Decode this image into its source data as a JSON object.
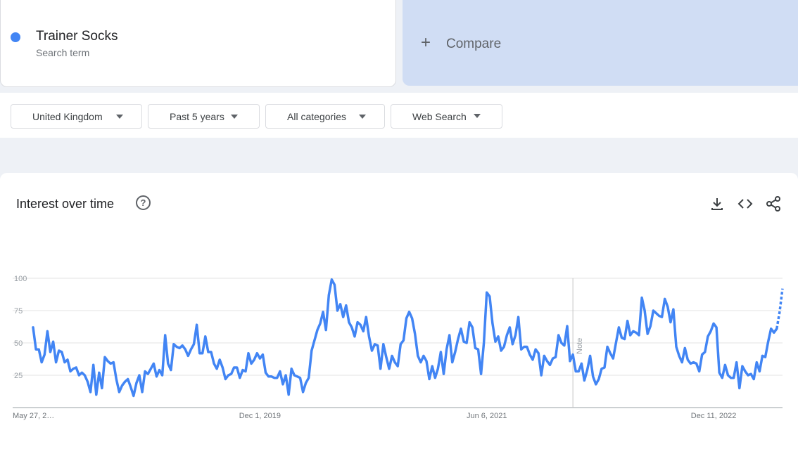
{
  "term": {
    "name": "Trainer Socks",
    "subtitle": "Search term",
    "color": "#4285f4"
  },
  "compare": {
    "label": "Compare"
  },
  "filters": [
    {
      "label": "United Kingdom"
    },
    {
      "label": "Past 5 years"
    },
    {
      "label": "All categories"
    },
    {
      "label": "Web Search"
    }
  ],
  "chart": {
    "title": "Interest over time",
    "icons": [
      "help-icon",
      "download-icon",
      "embed-icon",
      "share-icon"
    ],
    "note_label": "Note"
  },
  "chart_data": {
    "type": "line",
    "title": "Interest over time",
    "xlabel": "",
    "ylabel": "",
    "ylim": [
      0,
      100
    ],
    "yticks": [
      25,
      50,
      75,
      100
    ],
    "grid": true,
    "x_tick_labels": [
      "May 27, 2…",
      "Dec 1, 2019",
      "Jun 6, 2021",
      "Dec 11, 2022"
    ],
    "x_start": "2018-05-27",
    "x_step_days": 7,
    "note_date": "2022-01-02",
    "partial_last_points": 2,
    "series": [
      {
        "name": "Trainer Socks",
        "color": "#4285f4",
        "values": [
          62,
          45,
          45,
          35,
          41,
          59,
          43,
          51,
          35,
          44,
          43,
          35,
          37,
          28,
          30,
          31,
          25,
          27,
          25,
          20,
          12,
          33,
          10,
          27,
          15,
          39,
          36,
          34,
          35,
          22,
          12,
          17,
          20,
          22,
          16,
          9,
          19,
          25,
          12,
          28,
          26,
          30,
          34,
          24,
          29,
          25,
          56,
          34,
          29,
          49,
          47,
          46,
          48,
          45,
          40,
          45,
          49,
          64,
          42,
          42,
          55,
          43,
          43,
          34,
          30,
          37,
          31,
          22,
          25,
          26,
          31,
          31,
          23,
          29,
          28,
          42,
          34,
          37,
          42,
          38,
          41,
          27,
          24,
          24,
          23,
          23,
          28,
          18,
          25,
          10,
          30,
          25,
          24,
          23,
          12,
          19,
          23,
          44,
          52,
          60,
          65,
          74,
          60,
          87,
          99,
          95,
          75,
          80,
          70,
          79,
          66,
          62,
          55,
          66,
          64,
          59,
          70,
          55,
          44,
          49,
          48,
          30,
          49,
          39,
          30,
          40,
          35,
          32,
          49,
          52,
          69,
          74,
          69,
          57,
          40,
          35,
          40,
          36,
          22,
          32,
          23,
          30,
          43,
          26,
          45,
          56,
          35,
          43,
          53,
          61,
          51,
          50,
          66,
          62,
          46,
          45,
          26,
          50,
          89,
          86,
          65,
          51,
          55,
          44,
          47,
          56,
          62,
          49,
          56,
          70,
          45,
          47,
          47,
          41,
          37,
          45,
          42,
          25,
          40,
          36,
          33,
          38,
          39,
          56,
          50,
          48,
          63,
          36,
          41,
          28,
          28,
          34,
          21,
          29,
          40,
          24,
          18,
          22,
          30,
          31,
          47,
          42,
          38,
          50,
          62,
          54,
          53,
          67,
          56,
          59,
          58,
          56,
          85,
          75,
          57,
          63,
          75,
          73,
          71,
          70,
          84,
          78,
          66,
          76,
          47,
          40,
          35,
          46,
          37,
          34,
          35,
          34,
          28,
          41,
          43,
          55,
          59,
          65,
          62,
          27,
          23,
          33,
          25,
          23,
          23,
          35,
          15,
          32,
          28,
          25,
          26,
          22,
          35,
          28,
          40,
          39,
          51,
          61,
          58,
          61,
          74,
          92
        ]
      }
    ]
  }
}
